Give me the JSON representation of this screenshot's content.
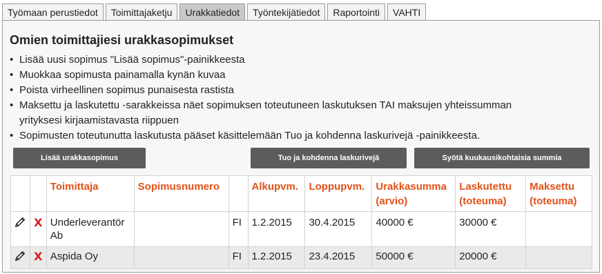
{
  "tabs": [
    {
      "label": "Työmaan perustiedot",
      "active": false
    },
    {
      "label": "Toimittajaketju",
      "active": false
    },
    {
      "label": "Urakkatiedot",
      "active": true
    },
    {
      "label": "Työntekijätiedot",
      "active": false
    },
    {
      "label": "Raportointi",
      "active": false
    },
    {
      "label": "VAHTI",
      "active": false
    }
  ],
  "heading": "Omien toimittajiesi urakkasopimukset",
  "instructions": [
    "Lisää uusi sopimus \"Lisää sopimus\"-painikkeesta",
    "Muokkaa sopimusta painamalla kynän kuvaa",
    "Poista virheellinen sopimus punaisesta rastista",
    "Maksettu ja laskutettu -sarakkeissa näet sopimuksen toteutuneen laskutuksen TAI maksujen yhteissumman yrityksesi kirjaamistavasta riippuen",
    "Sopimusten toteutunutta laskutusta pääset käsittelemään Tuo ja kohdenna laskurivejä -painikkeesta."
  ],
  "buttons": {
    "add": "Lisää urakkasopimus",
    "import": "Tuo ja kohdenna laskurivejä",
    "monthly": "Syötä kuukausikohtaisia summia"
  },
  "table": {
    "headers": {
      "supplier": "Toimittaja",
      "contract_no": "Sopimusnumero",
      "start": "Alkupvm.",
      "end": "Loppupvm.",
      "amount": "Urakkasumma (arvio)",
      "invoiced": "Laskutettu (toteuma)",
      "paid": "Maksettu (toteuma)"
    },
    "delete_symbol": "X",
    "rows": [
      {
        "supplier": "Underleverantör Ab",
        "contract_no": "",
        "country": "FI",
        "start": "1.2.2015",
        "end": "30.4.2015",
        "amount": "40000 €",
        "invoiced": "30000 €",
        "paid": ""
      },
      {
        "supplier": "Aspida Oy",
        "contract_no": "",
        "country": "FI",
        "start": "1.2.2015",
        "end": "23.4.2015",
        "amount": "50000 €",
        "invoiced": "20000 €",
        "paid": ""
      }
    ]
  },
  "icons": {
    "edit": "pencil-icon",
    "delete": "delete-x-icon"
  },
  "colors": {
    "header_text": "#e0521a",
    "delete": "#d01f1f",
    "button_bg": "#5c5c5c",
    "active_tab": "#c9c9c9"
  }
}
